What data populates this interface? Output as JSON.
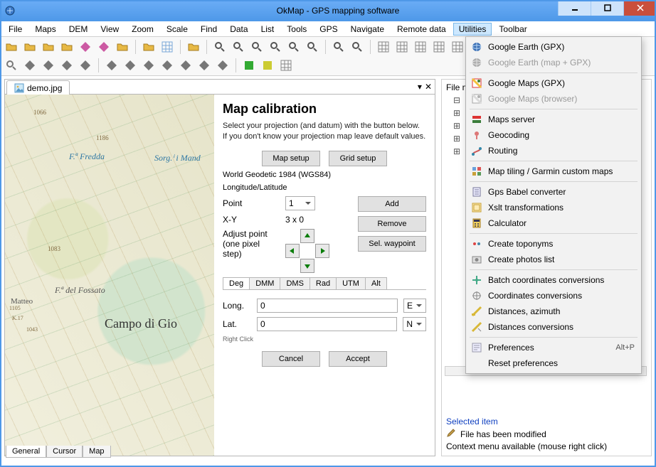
{
  "window": {
    "title": "OkMap - GPS mapping software"
  },
  "menu": {
    "items": [
      "File",
      "Maps",
      "DEM",
      "View",
      "Zoom",
      "Scale",
      "Find",
      "Data",
      "List",
      "Tools",
      "GPS",
      "Navigate",
      "Remote data",
      "Utilities",
      "Toolbar"
    ],
    "active_index": 13
  },
  "doc": {
    "tab_label": "demo.jpg",
    "bottom_tabs": [
      "General",
      "Cursor",
      "Map"
    ],
    "active_bottom_tab": 0
  },
  "calibration": {
    "title": "Map calibration",
    "desc": "Select your projection (and datum) with the button below. If you don't know your projection map leave default values.",
    "buttons": {
      "map_setup": "Map setup",
      "grid_setup": "Grid setup"
    },
    "projection": "World Geodetic 1984 (WGS84)",
    "coord_system": "Longitude/Latitude",
    "point_label": "Point",
    "point_value": "1",
    "xy_label": "X-Y",
    "xy_value": "3 x 0",
    "adjust_label": "Adjust point (one pixel step)",
    "add": "Add",
    "remove": "Remove",
    "sel_waypoint": "Sel. waypoint",
    "tabs": [
      "Deg",
      "DMM",
      "DMS",
      "Rad",
      "UTM",
      "Alt"
    ],
    "long_label": "Long.",
    "long_value": "0",
    "long_hemi": "E",
    "lat_label": "Lat.",
    "lat_value": "0",
    "lat_hemi": "N",
    "hint": "Right Click",
    "cancel": "Cancel",
    "accept": "Accept"
  },
  "map_labels": {
    "campo": "Campo di Gio",
    "fredda": "F.ª Fredda",
    "sorg": "Sorg.ⁱ i Mand",
    "matteo": "Matteo",
    "fossato": "F.ª del Fossato"
  },
  "right": {
    "header": "File ma",
    "selected_title": "Selected item",
    "modified": "File has been modified",
    "context": "Context menu available (mouse right click)"
  },
  "utilities_menu": [
    {
      "label": "Google Earth (GPX)",
      "enabled": true,
      "icon": "globe"
    },
    {
      "label": "Google Earth (map + GPX)",
      "enabled": false,
      "icon": "globe-gray"
    },
    {
      "sep": true
    },
    {
      "label": "Google Maps (GPX)",
      "enabled": true,
      "icon": "gmaps"
    },
    {
      "label": "Google Maps (browser)",
      "enabled": false,
      "icon": "gmaps-gray"
    },
    {
      "sep": true
    },
    {
      "label": "Maps server",
      "enabled": true,
      "icon": "server"
    },
    {
      "label": "Geocoding",
      "enabled": true,
      "icon": "geocode"
    },
    {
      "label": "Routing",
      "enabled": true,
      "icon": "route"
    },
    {
      "sep": true
    },
    {
      "label": "Map tiling / Garmin custom maps",
      "enabled": true,
      "icon": "tiles"
    },
    {
      "sep": true
    },
    {
      "label": "Gps Babel converter",
      "enabled": true,
      "icon": "babel"
    },
    {
      "label": "Xslt transformations",
      "enabled": true,
      "icon": "xslt"
    },
    {
      "label": "Calculator",
      "enabled": true,
      "icon": "calc"
    },
    {
      "sep": true
    },
    {
      "label": "Create toponyms",
      "enabled": true,
      "icon": "topo"
    },
    {
      "label": "Create photos list",
      "enabled": true,
      "icon": "photos"
    },
    {
      "sep": true
    },
    {
      "label": "Batch coordinates conversions",
      "enabled": true,
      "icon": "batch"
    },
    {
      "label": "Coordinates conversions",
      "enabled": true,
      "icon": "coords"
    },
    {
      "label": "Distances, azimuth",
      "enabled": true,
      "icon": "dist"
    },
    {
      "label": "Distances conversions",
      "enabled": true,
      "icon": "distconv"
    },
    {
      "sep": true
    },
    {
      "label": "Preferences",
      "enabled": true,
      "icon": "prefs",
      "shortcut": "Alt+P"
    },
    {
      "label": "Reset preferences",
      "enabled": true,
      "icon": ""
    }
  ]
}
